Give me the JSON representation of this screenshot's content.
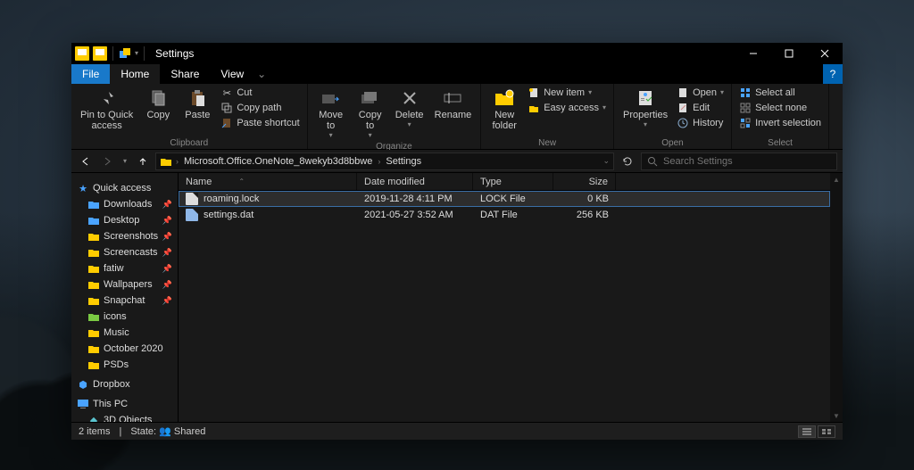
{
  "titlebar": {
    "title": "Settings"
  },
  "ribbon_tabs": {
    "file": "File",
    "home": "Home",
    "share": "Share",
    "view": "View"
  },
  "ribbon": {
    "clipboard": {
      "pin": "Pin to Quick\naccess",
      "copy": "Copy",
      "paste": "Paste",
      "cut": "Cut",
      "copy_path": "Copy path",
      "paste_shortcut": "Paste shortcut",
      "label": "Clipboard"
    },
    "organize": {
      "move_to": "Move\nto",
      "copy_to": "Copy\nto",
      "delete": "Delete",
      "rename": "Rename",
      "label": "Organize"
    },
    "new": {
      "new_folder": "New\nfolder",
      "new_item": "New item",
      "easy_access": "Easy access",
      "label": "New"
    },
    "open": {
      "properties": "Properties",
      "open": "Open",
      "edit": "Edit",
      "history": "History",
      "label": "Open"
    },
    "select": {
      "select_all": "Select all",
      "select_none": "Select none",
      "invert": "Invert selection",
      "label": "Select"
    }
  },
  "address": {
    "seg1": "Microsoft.Office.OneNote_8wekyb3d8bbwe",
    "seg2": "Settings"
  },
  "search": {
    "placeholder": "Search Settings"
  },
  "sidebar": {
    "quick_access": "Quick access",
    "items": [
      {
        "label": "Downloads",
        "color": "#4aa3ff",
        "pinned": true
      },
      {
        "label": "Desktop",
        "color": "#4aa3ff",
        "pinned": true
      },
      {
        "label": "Screenshots",
        "color": "#ffcc00",
        "pinned": true
      },
      {
        "label": "Screencasts",
        "color": "#ffcc00",
        "pinned": true
      },
      {
        "label": "fatiw",
        "color": "#ffcc00",
        "pinned": true
      },
      {
        "label": "Wallpapers",
        "color": "#ffcc00",
        "pinned": true
      },
      {
        "label": "Snapchat",
        "color": "#ffcc00",
        "pinned": true
      },
      {
        "label": "icons",
        "color": "#7ac943",
        "pinned": false
      },
      {
        "label": "Music",
        "color": "#ffcc00",
        "pinned": false
      },
      {
        "label": "October 2020",
        "color": "#ffcc00",
        "pinned": false
      },
      {
        "label": "PSDs",
        "color": "#ffcc00",
        "pinned": false
      }
    ],
    "dropbox": "Dropbox",
    "this_pc": "This PC",
    "objects3d": "3D Objects"
  },
  "columns": {
    "name": "Name",
    "date": "Date modified",
    "type": "Type",
    "size": "Size"
  },
  "files": [
    {
      "name": "roaming.lock",
      "date": "2019-11-28 4:11 PM",
      "type": "LOCK File",
      "size": "0 KB",
      "kind": "lock",
      "selected": true
    },
    {
      "name": "settings.dat",
      "date": "2021-05-27 3:52 AM",
      "type": "DAT File",
      "size": "256 KB",
      "kind": "dat",
      "selected": false
    }
  ],
  "status": {
    "count": "2 items",
    "state_label": "State:",
    "state_value": "Shared"
  }
}
